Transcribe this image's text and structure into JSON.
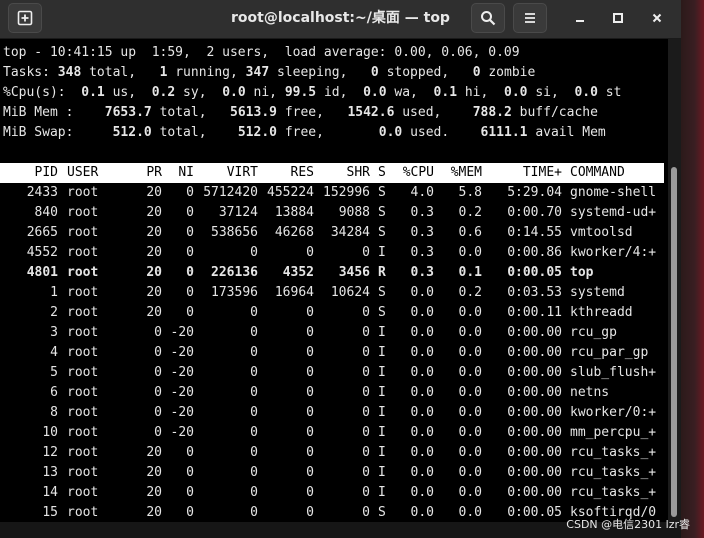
{
  "window": {
    "title": "root@localhost:~/桌面 — top",
    "buttons": {
      "new_tab": "new-tab-icon",
      "search": "search-icon",
      "menu": "hamburger-menu-icon",
      "minimize": "minimize-icon",
      "maximize": "maximize-icon",
      "close": "close-icon"
    }
  },
  "summary": {
    "line1": "top - 10:41:15 up  1:59,  2 users,  load average: 0.00, 0.06, 0.09",
    "tasks": {
      "label": "Tasks:",
      "total": "348",
      "total_label": "total,",
      "running": "1",
      "running_label": "running,",
      "sleeping": "347",
      "sleeping_label": "sleeping,",
      "stopped": "0",
      "stopped_label": "stopped,",
      "zombie": "0",
      "zombie_label": "zombie"
    },
    "cpu": {
      "label": "%Cpu(s):",
      "us": "0.1",
      "us_label": "us,",
      "sy": "0.2",
      "sy_label": "sy,",
      "ni": "0.0",
      "ni_label": "ni,",
      "id": "99.5",
      "id_label": "id,",
      "wa": "0.0",
      "wa_label": "wa,",
      "hi": "0.1",
      "hi_label": "hi,",
      "si": "0.0",
      "si_label": "si,",
      "st": "0.0",
      "st_label": "st"
    },
    "mem": {
      "label": "MiB Mem :",
      "total": "7653.7",
      "total_label": "total,",
      "free": "5613.9",
      "free_label": "free,",
      "used": "1542.6",
      "used_label": "used,",
      "buff": "788.2",
      "buff_label": "buff/cache"
    },
    "swap": {
      "label": "MiB Swap:",
      "total": "512.0",
      "total_label": "total,",
      "free": "512.0",
      "free_label": "free,",
      "used": "0.0",
      "used_label": "used.",
      "avail": "6111.1",
      "avail_label": "avail Mem"
    }
  },
  "columns": [
    "PID",
    "USER",
    "PR",
    "NI",
    "VIRT",
    "RES",
    "SHR",
    "S",
    "%CPU",
    "%MEM",
    "TIME+",
    "COMMAND"
  ],
  "processes": [
    [
      "2433",
      "root",
      "20",
      "0",
      "5712420",
      "455224",
      "152996",
      "S",
      "4.0",
      "5.8",
      "5:29.04",
      "gnome-shell"
    ],
    [
      "840",
      "root",
      "20",
      "0",
      "37124",
      "13884",
      "9088",
      "S",
      "0.3",
      "0.2",
      "0:00.70",
      "systemd-ud+"
    ],
    [
      "2665",
      "root",
      "20",
      "0",
      "538656",
      "46268",
      "34284",
      "S",
      "0.3",
      "0.6",
      "0:14.55",
      "vmtoolsd"
    ],
    [
      "4552",
      "root",
      "20",
      "0",
      "0",
      "0",
      "0",
      "I",
      "0.3",
      "0.0",
      "0:00.86",
      "kworker/4:+"
    ],
    [
      "4801",
      "root",
      "20",
      "0",
      "226136",
      "4352",
      "3456",
      "R",
      "0.3",
      "0.1",
      "0:00.05",
      "top"
    ],
    [
      "1",
      "root",
      "20",
      "0",
      "173596",
      "16964",
      "10624",
      "S",
      "0.0",
      "0.2",
      "0:03.53",
      "systemd"
    ],
    [
      "2",
      "root",
      "20",
      "0",
      "0",
      "0",
      "0",
      "S",
      "0.0",
      "0.0",
      "0:00.11",
      "kthreadd"
    ],
    [
      "3",
      "root",
      "0",
      "-20",
      "0",
      "0",
      "0",
      "I",
      "0.0",
      "0.0",
      "0:00.00",
      "rcu_gp"
    ],
    [
      "4",
      "root",
      "0",
      "-20",
      "0",
      "0",
      "0",
      "I",
      "0.0",
      "0.0",
      "0:00.00",
      "rcu_par_gp"
    ],
    [
      "5",
      "root",
      "0",
      "-20",
      "0",
      "0",
      "0",
      "I",
      "0.0",
      "0.0",
      "0:00.00",
      "slub_flush+"
    ],
    [
      "6",
      "root",
      "0",
      "-20",
      "0",
      "0",
      "0",
      "I",
      "0.0",
      "0.0",
      "0:00.00",
      "netns"
    ],
    [
      "8",
      "root",
      "0",
      "-20",
      "0",
      "0",
      "0",
      "I",
      "0.0",
      "0.0",
      "0:00.00",
      "kworker/0:+"
    ],
    [
      "10",
      "root",
      "0",
      "-20",
      "0",
      "0",
      "0",
      "I",
      "0.0",
      "0.0",
      "0:00.00",
      "mm_percpu_+"
    ],
    [
      "12",
      "root",
      "20",
      "0",
      "0",
      "0",
      "0",
      "I",
      "0.0",
      "0.0",
      "0:00.00",
      "rcu_tasks_+"
    ],
    [
      "13",
      "root",
      "20",
      "0",
      "0",
      "0",
      "0",
      "I",
      "0.0",
      "0.0",
      "0:00.00",
      "rcu_tasks_+"
    ],
    [
      "14",
      "root",
      "20",
      "0",
      "0",
      "0",
      "0",
      "I",
      "0.0",
      "0.0",
      "0:00.00",
      "rcu_tasks_+"
    ],
    [
      "15",
      "root",
      "20",
      "0",
      "0",
      "0",
      "0",
      "S",
      "0.0",
      "0.0",
      "0:00.05",
      "ksoftirqd/0"
    ]
  ],
  "bold_row": 4,
  "watermark": "CSDN @电信2301 lzr睿",
  "colors": {
    "terminal_bg": "#000000",
    "terminal_fg": "#e6e6e6",
    "header_bg": "#ffffff",
    "titlebar_bg": "#2f2f2f"
  }
}
